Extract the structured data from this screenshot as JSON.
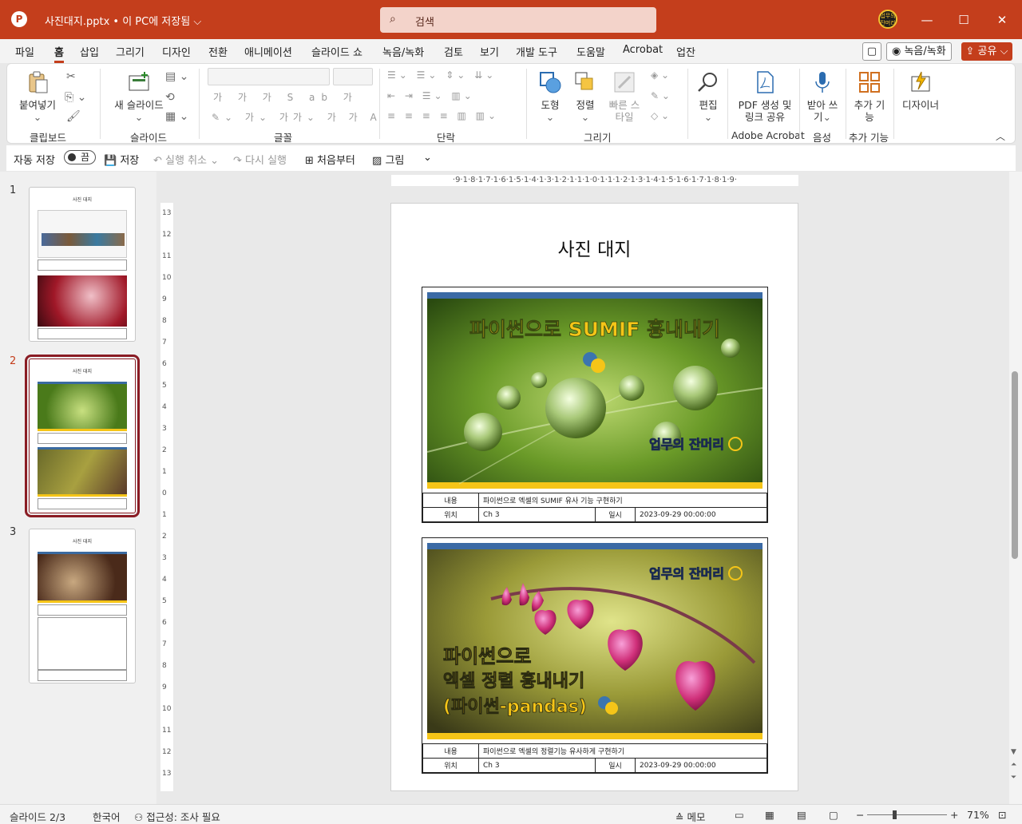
{
  "window": {
    "app_icon": "P",
    "doc_title": "사진대지.pptx • 이 PC에 저장됨 ⌵",
    "search_placeholder": "검색",
    "avatar_text": "업무의 잔머리",
    "minimize": "—",
    "maximize": "☐",
    "close": "✕"
  },
  "menu": {
    "tabs": [
      "파일",
      "홈",
      "삽입",
      "그리기",
      "디자인",
      "전환",
      "애니메이션",
      "슬라이드 쇼",
      "녹음/녹화",
      "검토",
      "보기",
      "개발 도구",
      "도움말",
      "Acrobat",
      "업잔"
    ],
    "active_tab": "홈",
    "comment_button": "▢",
    "record_button": "◉ 녹음/녹화",
    "share_button": "⇪ 공유 ⌵"
  },
  "ribbon": {
    "clipboard": {
      "paste": "붙여넣기",
      "label": "클립보드"
    },
    "slides": {
      "new_slide": "새 슬라이드",
      "label": "슬라이드"
    },
    "font": {
      "label": "글꼴"
    },
    "paragraph": {
      "label": "단락"
    },
    "drawing": {
      "shape": "도형",
      "arrange": "정렬",
      "quick_style": "빠른 스타일",
      "label": "그리기"
    },
    "editing": {
      "edit": "편집"
    },
    "acrobat": {
      "pdf": "PDF 생성 및 링크 공유",
      "label": "Adobe Acrobat"
    },
    "voice": {
      "dictate": "받아 쓰기",
      "label": "음성"
    },
    "addins": {
      "addins": "추가 기능",
      "label": "추가 기능"
    },
    "designer": {
      "designer": "디자이너"
    },
    "collapse": "︿"
  },
  "quick_access": {
    "autosave": "자동 저장",
    "toggle": "끔",
    "save": "저장",
    "undo": "실행 취소",
    "redo": "다시 실행",
    "from_start": "처음부터",
    "picture": "그림",
    "more": "⌄"
  },
  "thumbnails": [
    {
      "number": "1",
      "title": "사진 대지"
    },
    {
      "number": "2",
      "title": "사진 대지"
    },
    {
      "number": "3",
      "title": "사진 대지"
    }
  ],
  "ruler": {
    "horizontal": "·9·1·8·1·7·1·6·1·5·1·4·1·3·1·2·1·1·1·0·1·1·1·2·1·3·1·4·1·5·1·6·1·7·1·8·1·9·",
    "vertical": [
      "13",
      "12",
      "11",
      "10",
      "9",
      "8",
      "7",
      "6",
      "5",
      "4",
      "3",
      "2",
      "1",
      "0",
      "1",
      "2",
      "3",
      "4",
      "5",
      "6",
      "7",
      "8",
      "9",
      "10",
      "11",
      "12",
      "13"
    ]
  },
  "slide": {
    "title": "사진 대지",
    "photos": [
      {
        "image_text_1": "파이썬으로 SUMIF 흉내내기",
        "brand": "업무의 잔머리",
        "content_label": "내용",
        "content_value": "파이썬으로 엑셀의 SUMIF 유사 기능 구현하기",
        "location_label": "위치",
        "location_value": "Ch 3",
        "date_label": "일시",
        "date_value": "2023-09-29 00:00:00"
      },
      {
        "image_text_1": "파이썬으로",
        "image_text_2": "엑셀 정렬 흉내내기",
        "image_text_3": "(파이썬-pandas)",
        "brand": "업무의 잔머리",
        "content_label": "내용",
        "content_value": "파이썬으로 엑셀의 정렬기능 유사하게 구현하기",
        "location_label": "위치",
        "location_value": "Ch 3",
        "date_label": "일시",
        "date_value": "2023-09-29 00:00:00"
      }
    ]
  },
  "status": {
    "slide_pos": "슬라이드 2/3",
    "language": "한국어",
    "accessibility": "접근성: 조사 필요",
    "notes": "≙ 메모",
    "zoom_minus": "−",
    "zoom_plus": "+",
    "zoom": "71%"
  },
  "colors": {
    "accent": "#c43e1c",
    "thumb_selected": "#8a1c24"
  }
}
